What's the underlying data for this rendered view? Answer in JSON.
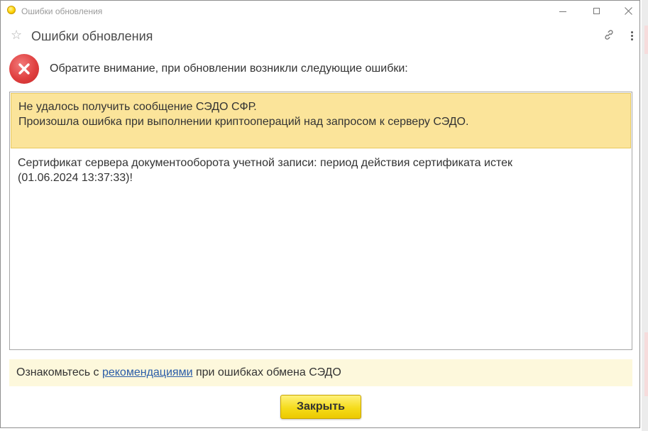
{
  "window": {
    "os_title": "Ошибки обновления",
    "icon": "app-yellow-circle-icon",
    "controls": {
      "minimize": "minimize-icon",
      "maximize": "maximize-icon",
      "close": "close-icon"
    }
  },
  "form": {
    "title": "Ошибки обновления",
    "favorite_icon": "star-icon",
    "link_icon": "link-icon",
    "more_icon": "more-vertical-icon"
  },
  "notice": {
    "icon": "error-icon",
    "text": "Обратите внимание, при обновлении возникли следующие ошибки:"
  },
  "errors": {
    "highlight_line1": "Не удалось получить сообщение СЭДО СФР.",
    "highlight_line2": "Произошла ошибка при выполнении криптоопераций над запросом к серверу СЭДО.",
    "detail_line1": "Сертификат сервера документооборота учетной записи: период действия сертификата истек",
    "detail_line2": "(01.06.2024 13:37:33)!"
  },
  "recommendation": {
    "prefix": "Ознакомьтесь с ",
    "link_text": "рекомендациями",
    "suffix": " при ошибках обмена СЭДО"
  },
  "buttons": {
    "close_label": "Закрыть"
  },
  "colors": {
    "highlight_bg": "#fbe49a",
    "recommend_bg": "#fdf8dc",
    "button_yellow": "#f5dc1c",
    "error_red": "#e04040",
    "link_blue": "#2a5ca8"
  }
}
